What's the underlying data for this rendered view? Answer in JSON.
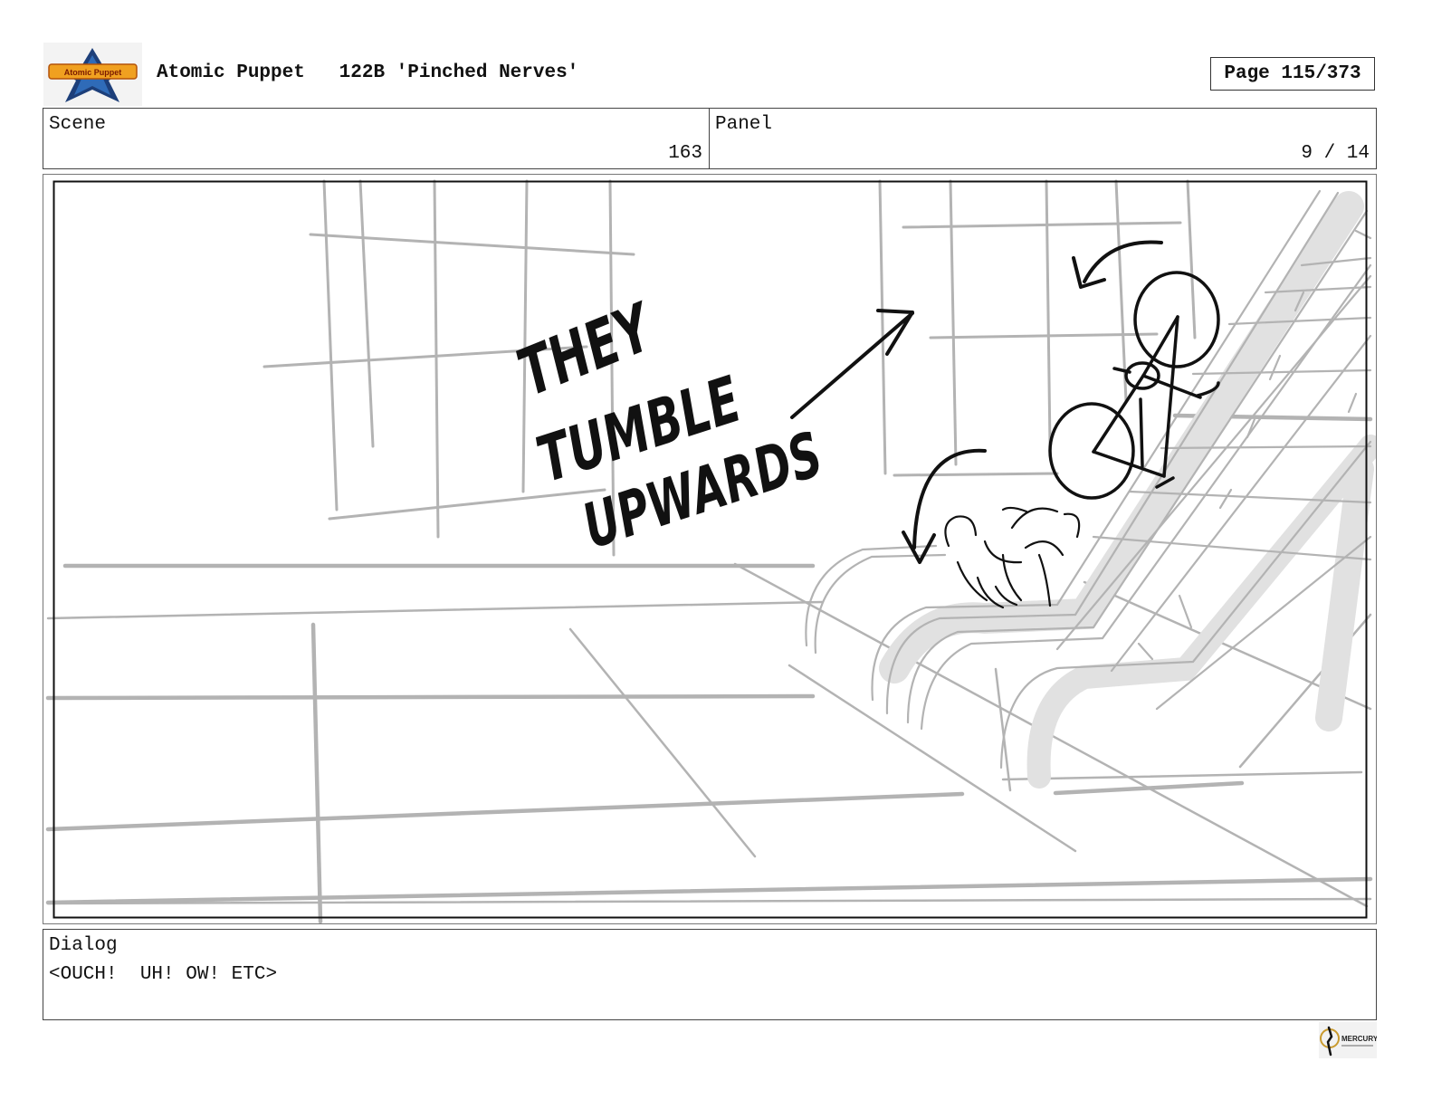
{
  "header": {
    "logo_icon": "atomic-puppet-logo",
    "show": "Atomic Puppet",
    "episode": "122B 'Pinched Nerves'",
    "page": "Page 115/373"
  },
  "info": {
    "scene_label": "Scene",
    "scene_value": "163",
    "panel_label": "Panel",
    "panel_value": "9 / 14"
  },
  "panel_art": {
    "annotation_lines": [
      "THEY",
      "TUMBLE",
      "UPWARDS"
    ],
    "line_color": "#b3b3b3",
    "ink_color": "#111111"
  },
  "dialog": {
    "label": "Dialog",
    "text": "<OUCH!  UH! OW! ETC>"
  },
  "footer": {
    "studio_icon": "mercury-filmworks-logo",
    "studio_text": "MERCURY"
  }
}
